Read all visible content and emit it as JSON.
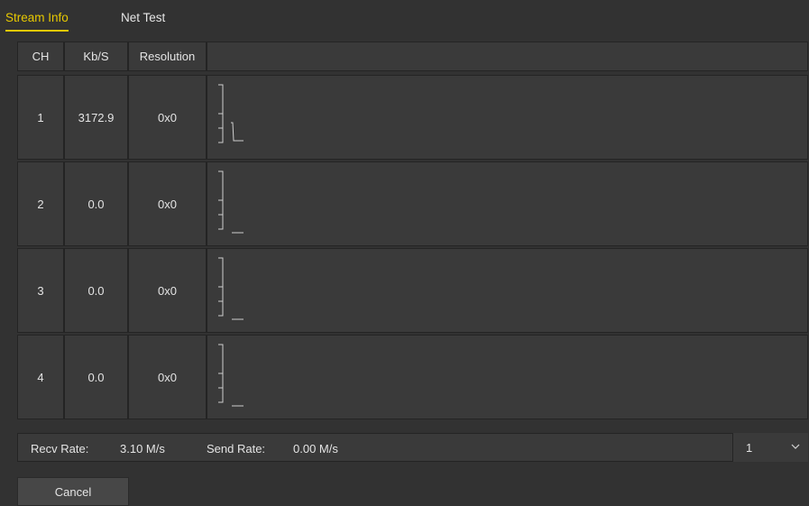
{
  "tabs": [
    {
      "label": "Stream Info",
      "active": true
    },
    {
      "label": "Net Test",
      "active": false
    }
  ],
  "table": {
    "headers": [
      "CH",
      "Kb/S",
      "Resolution",
      ""
    ],
    "rows": [
      {
        "ch": "1",
        "kbs": "3172.9",
        "resolution": "0x0",
        "graph": "drop"
      },
      {
        "ch": "2",
        "kbs": "0.0",
        "resolution": "0x0",
        "graph": "flat"
      },
      {
        "ch": "3",
        "kbs": "0.0",
        "resolution": "0x0",
        "graph": "flat"
      },
      {
        "ch": "4",
        "kbs": "0.0",
        "resolution": "0x0",
        "graph": "flat"
      }
    ]
  },
  "footer": {
    "recv_label": "Recv Rate:",
    "recv_value": "3.10 M/s",
    "send_label": "Send Rate:",
    "send_value": "0.00 M/s",
    "channel_select": "1",
    "channel_icon": "chevron-down-icon"
  },
  "buttons": {
    "cancel": "Cancel"
  },
  "colors": {
    "accent": "#e8c900",
    "background": "#323232",
    "cell": "#3a3a3a",
    "border": "#242424"
  }
}
